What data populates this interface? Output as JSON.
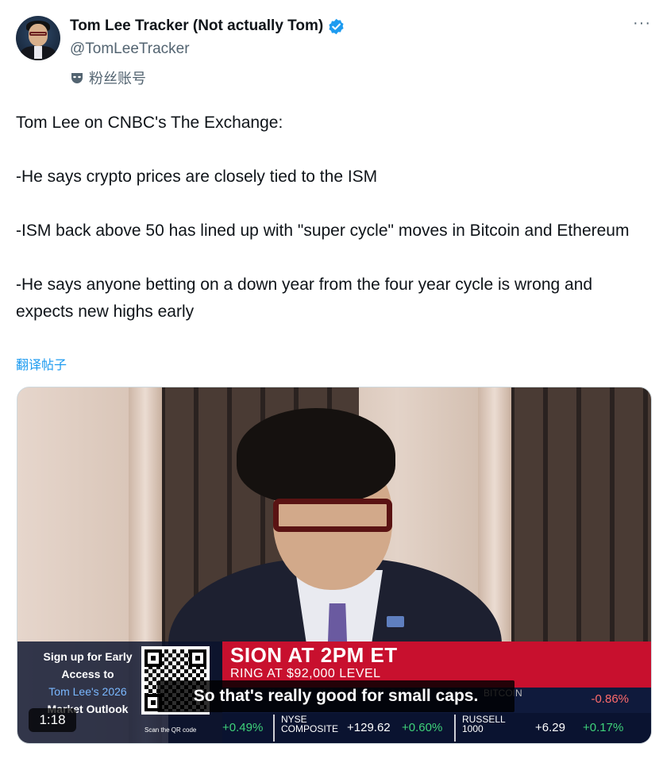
{
  "author": {
    "display_name": "Tom Lee Tracker (Not actually Tom)",
    "handle": "@TomLeeTracker",
    "fan_label": "粉丝账号",
    "verified": true
  },
  "more_label": "···",
  "tweet": {
    "lines": [
      "Tom Lee on CNBC's The Exchange:",
      "-He says crypto prices are closely tied to the ISM",
      "-ISM back above 50 has lined up with \"super cycle\" moves in Bitcoin and Ethereum",
      "-He says anyone betting on a down year from the four year cycle is wrong and expects new highs early"
    ],
    "translate_label": "翻译帖子"
  },
  "video": {
    "promo": {
      "line1": "Sign up for Early Access to",
      "line2": "Tom Lee's 2026",
      "line3": "Market Outlook",
      "qr_caption": "Scan the QR code"
    },
    "headline": "SION AT 2PM ET",
    "subhead": "RING AT $92,000 LEVEL",
    "bitcoin_label": "BITCOIN",
    "bitcoin_change": "-0.86%",
    "caption": "So that's really good for small caps.",
    "time": "1:18",
    "ticker": {
      "first_change": "+0.49%",
      "nyse_label_1": "NYSE",
      "nyse_label_2": "COMPOSITE",
      "nyse_value": "+129.62",
      "nyse_change": "+0.60%",
      "russell_label_1": "RUSSELL",
      "russell_label_2": "1000",
      "russell_value": "+6.29",
      "russell_change": "+0.17%"
    }
  },
  "colors": {
    "link_blue": "#1d9bf0",
    "verified_blue": "#1d9bf0",
    "cnbc_red": "#c8102e"
  }
}
